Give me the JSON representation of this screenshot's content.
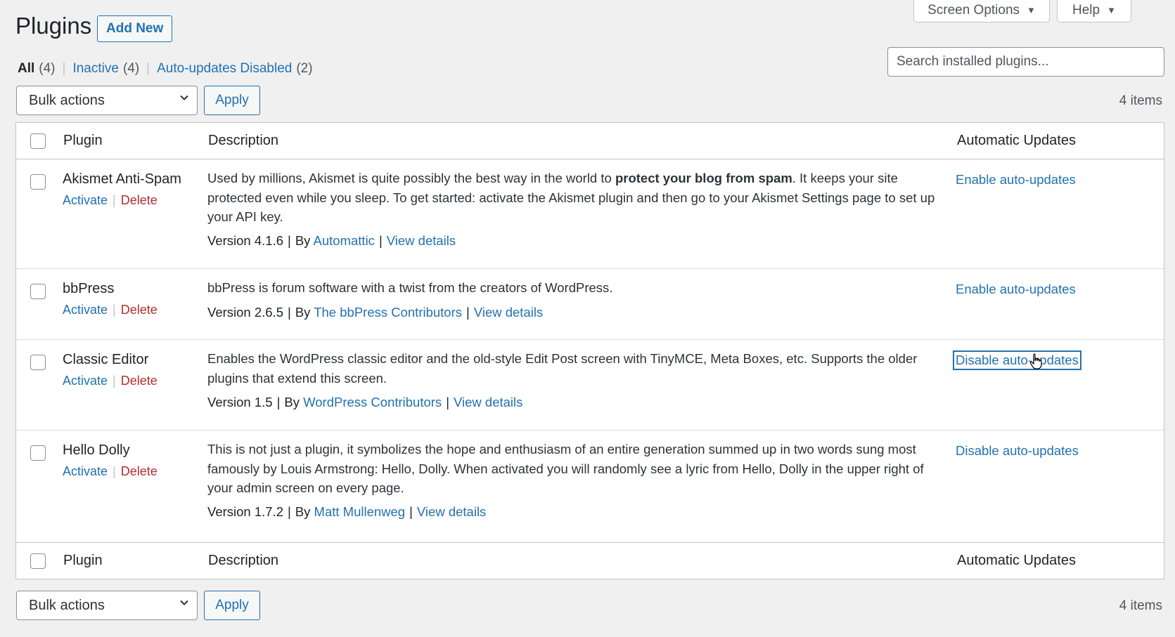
{
  "header": {
    "screen_options": "Screen Options",
    "help": "Help",
    "title": "Plugins",
    "add_new": "Add New"
  },
  "filters": {
    "all": "All",
    "all_count": "(4)",
    "inactive": "Inactive",
    "inactive_count": "(4)",
    "auto_disabled": "Auto-updates Disabled",
    "auto_disabled_count": "(2)"
  },
  "search": {
    "placeholder": "Search installed plugins..."
  },
  "toolbar": {
    "bulk_actions": "Bulk actions",
    "apply": "Apply",
    "items": "4 items"
  },
  "table": {
    "columns": [
      "Plugin",
      "Description",
      "Automatic Updates"
    ],
    "plugins": [
      {
        "name": "Akismet Anti-Spam",
        "activate": "Activate",
        "delete": "Delete",
        "desc_before": "Used by millions, Akismet is quite possibly the best way in the world to ",
        "desc_bold": "protect your blog from spam",
        "desc_after": ". It keeps your site protected even while you sleep. To get started: activate the Akismet plugin and then go to your Akismet Settings page to set up your API key.",
        "version": "Version 4.1.6",
        "by": "By",
        "author": "Automattic",
        "view_details": "View details",
        "auto_updates": "Enable auto-updates"
      },
      {
        "name": "bbPress",
        "activate": "Activate",
        "delete": "Delete",
        "desc": "bbPress is forum software with a twist from the creators of WordPress.",
        "version": "Version 2.6.5",
        "by": "By",
        "author": "The bbPress Contributors",
        "view_details": "View details",
        "auto_updates": "Enable auto-updates"
      },
      {
        "name": "Classic Editor",
        "activate": "Activate",
        "delete": "Delete",
        "desc": "Enables the WordPress classic editor and the old-style Edit Post screen with TinyMCE, Meta Boxes, etc. Supports the older plugins that extend this screen.",
        "version": "Version 1.5",
        "by": "By",
        "author": "WordPress Contributors",
        "view_details": "View details",
        "auto_updates": "Disable auto-updates"
      },
      {
        "name": "Hello Dolly",
        "activate": "Activate",
        "delete": "Delete",
        "desc": "This is not just a plugin, it symbolizes the hope and enthusiasm of an entire generation summed up in two words sung most famously by Louis Armstrong: Hello, Dolly. When activated you will randomly see a lyric from Hello, Dolly in the upper right of your admin screen on every page.",
        "version": "Version 1.7.2",
        "by": "By",
        "author": "Matt Mullenweg",
        "view_details": "View details",
        "auto_updates": "Disable auto-updates"
      }
    ]
  }
}
